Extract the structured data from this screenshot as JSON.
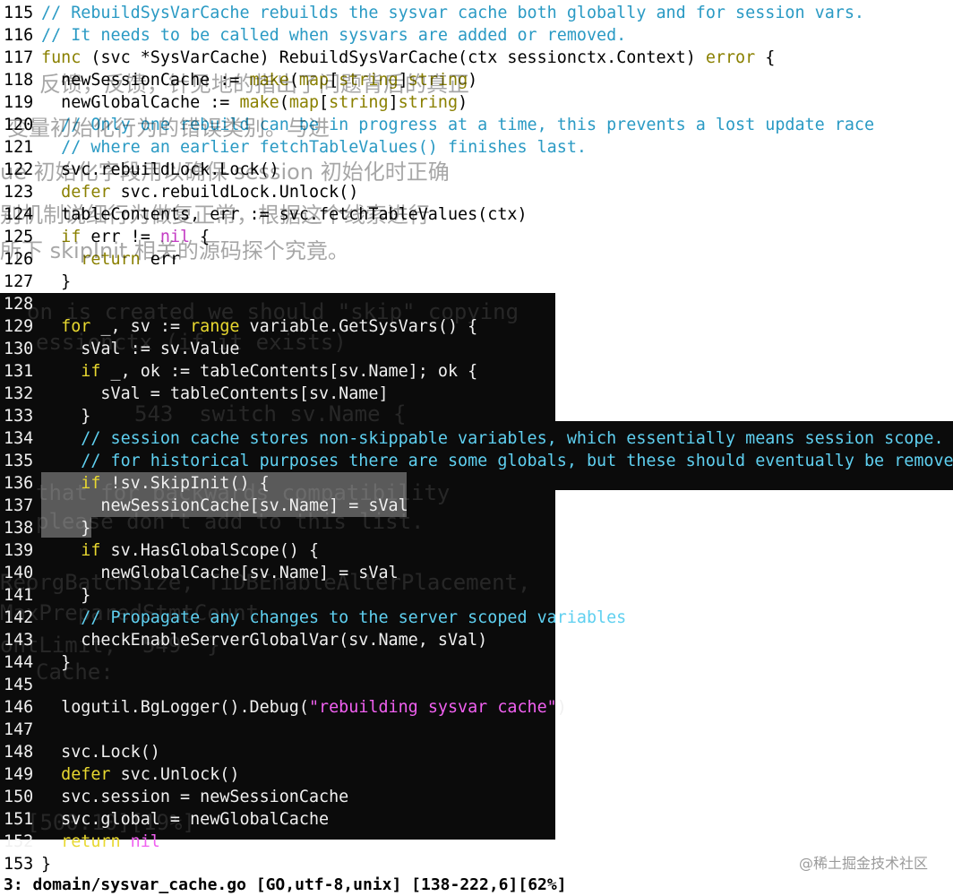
{
  "editor": {
    "lines": [
      {
        "n": "115",
        "segs": [
          [
            "com",
            "// RebuildSysVarCache rebuilds the sysvar cache both globally and for session vars."
          ]
        ]
      },
      {
        "n": "116",
        "segs": [
          [
            "com",
            "// It needs to be called when sysvars are added or removed."
          ]
        ]
      },
      {
        "n": "117",
        "segs": [
          [
            "kw",
            "func"
          ],
          [
            "plain",
            " (svc *SysVarCache) RebuildSysVarCache(ctx sessionctx.Context) "
          ],
          [
            "type",
            "error"
          ],
          [
            "plain",
            " {"
          ]
        ]
      },
      {
        "n": "118",
        "segs": [
          [
            "plain",
            "  newSessionCache := "
          ],
          [
            "kw",
            "make"
          ],
          [
            "plain",
            "("
          ],
          [
            "kw",
            "map"
          ],
          [
            "plain",
            "["
          ],
          [
            "type",
            "string"
          ],
          [
            "plain",
            "]"
          ],
          [
            "type",
            "string"
          ],
          [
            "plain",
            ")"
          ]
        ]
      },
      {
        "n": "119",
        "segs": [
          [
            "plain",
            "  newGlobalCache := "
          ],
          [
            "kw",
            "make"
          ],
          [
            "plain",
            "("
          ],
          [
            "kw",
            "map"
          ],
          [
            "plain",
            "["
          ],
          [
            "type",
            "string"
          ],
          [
            "plain",
            "]"
          ],
          [
            "type",
            "string"
          ],
          [
            "plain",
            ")"
          ]
        ]
      },
      {
        "n": "120",
        "segs": [
          [
            "com",
            "  // Only one rebuild can be in progress at a time, this prevents a lost update race"
          ]
        ]
      },
      {
        "n": "121",
        "segs": [
          [
            "com",
            "  // where an earlier fetchTableValues() finishes last."
          ]
        ]
      },
      {
        "n": "122",
        "segs": [
          [
            "plain",
            "  svc.rebuildLock.Lock()"
          ]
        ]
      },
      {
        "n": "123",
        "segs": [
          [
            "kw",
            "  defer"
          ],
          [
            "plain",
            " svc.rebuildLock.Unlock()"
          ]
        ]
      },
      {
        "n": "124",
        "segs": [
          [
            "plain",
            "  tableContents, err := svc.fetchTableValues(ctx)"
          ]
        ]
      },
      {
        "n": "125",
        "segs": [
          [
            "kw",
            "  if"
          ],
          [
            "plain",
            " err != "
          ],
          [
            "str",
            "nil"
          ],
          [
            "plain",
            " {"
          ]
        ]
      },
      {
        "n": "126",
        "segs": [
          [
            "kw",
            "    return"
          ],
          [
            "plain",
            " err"
          ]
        ]
      },
      {
        "n": "127",
        "segs": [
          [
            "plain",
            "  }"
          ]
        ]
      },
      {
        "n": "128",
        "segs": [
          [
            "plain",
            ""
          ]
        ]
      },
      {
        "n": "129",
        "segs": [
          [
            "kw",
            "  for"
          ],
          [
            "plain",
            " _, sv := "
          ],
          [
            "kw",
            "range"
          ],
          [
            "plain",
            " variable.GetSysVars() {"
          ]
        ]
      },
      {
        "n": "130",
        "segs": [
          [
            "plain",
            "    sVal := sv.Value"
          ]
        ]
      },
      {
        "n": "131",
        "segs": [
          [
            "kw",
            "    if"
          ],
          [
            "plain",
            " _, ok := tableContents[sv.Name]; ok {"
          ]
        ]
      },
      {
        "n": "132",
        "segs": [
          [
            "plain",
            "      sVal = tableContents[sv.Name]"
          ]
        ]
      },
      {
        "n": "133",
        "segs": [
          [
            "plain",
            "    }"
          ]
        ]
      },
      {
        "n": "134",
        "segs": [
          [
            "com",
            "    // session cache stores non-skippable variables, which essentially means session scope."
          ]
        ]
      },
      {
        "n": "135",
        "segs": [
          [
            "com",
            "    // for historical purposes there are some globals, but these should eventually be removed."
          ]
        ]
      },
      {
        "n": "136",
        "segs": [
          [
            "kw",
            "    if"
          ],
          [
            "plain",
            " !sv.SkipInit() {"
          ]
        ]
      },
      {
        "n": "137",
        "segs": [
          [
            "plain",
            "      newSessionCache[sv.Name] = sVal"
          ]
        ]
      },
      {
        "n": "138",
        "segs": [
          [
            "plain",
            "    }"
          ]
        ]
      },
      {
        "n": "139",
        "segs": [
          [
            "kw",
            "    if"
          ],
          [
            "plain",
            " sv.HasGlobalScope() {"
          ]
        ]
      },
      {
        "n": "140",
        "segs": [
          [
            "plain",
            "      newGlobalCache[sv.Name] = sVal"
          ]
        ]
      },
      {
        "n": "141",
        "segs": [
          [
            "plain",
            "    }"
          ]
        ]
      },
      {
        "n": "142",
        "segs": [
          [
            "com",
            "    // Propagate any changes to the server scoped variables"
          ]
        ]
      },
      {
        "n": "143",
        "segs": [
          [
            "plain",
            "    checkEnableServerGlobalVar(sv.Name, sVal)"
          ]
        ]
      },
      {
        "n": "144",
        "segs": [
          [
            "plain",
            "  }"
          ]
        ]
      },
      {
        "n": "145",
        "segs": [
          [
            "plain",
            ""
          ]
        ]
      },
      {
        "n": "146",
        "segs": [
          [
            "plain",
            "  logutil.BgLogger().Debug("
          ],
          [
            "str",
            "\"rebuilding sysvar cache\""
          ],
          [
            "plain",
            ")"
          ]
        ]
      },
      {
        "n": "147",
        "segs": [
          [
            "plain",
            ""
          ]
        ]
      },
      {
        "n": "148",
        "segs": [
          [
            "plain",
            "  svc.Lock()"
          ]
        ]
      },
      {
        "n": "149",
        "segs": [
          [
            "kw",
            "  defer"
          ],
          [
            "plain",
            " svc.Unlock()"
          ]
        ]
      },
      {
        "n": "150",
        "segs": [
          [
            "plain",
            "  svc.session = newSessionCache"
          ]
        ]
      },
      {
        "n": "151",
        "segs": [
          [
            "plain",
            "  svc.global = newGlobalCache"
          ]
        ]
      },
      {
        "n": "152",
        "segs": [
          [
            "kw",
            "  return"
          ],
          [
            "plain",
            " "
          ],
          [
            "str",
            "nil"
          ]
        ]
      },
      {
        "n": "153",
        "segs": [
          [
            "plain",
            "}"
          ]
        ]
      }
    ]
  },
  "status": {
    "text": "3: domain/sysvar_cache.go [GO,utf-8,unix] [138-222,6][62%]"
  },
  "watermark": "@稀土掘金技术社区",
  "ghost_light": [
    {
      "text": "反馈，反馈，针见地的指出了问题背后的真正"
    },
    {
      "text": "变量初始化行为的错误类别。与进"
    },
    {
      "text": "ue 初始化字段用以确保 session 初始化时正确"
    },
    {
      "text": "别机制说细行为做复正常，根据这个线索进行"
    },
    {
      "text": "所下 skipInit 相关的源码探个究竟。"
    }
  ],
  "ghost_dark": [
    {
      "text": "on is created we should \"skip\" copying"
    },
    {
      "text": "essionctx (if it exists)"
    },
    {
      "text": "543  switch sv.Name {"
    },
    {
      "text": "that for backwards compatibility"
    },
    {
      "text": "please don't add to this list."
    },
    {
      "text": "ReorgBatchSize, TiDBEnableAlterPlacement,"
    },
    {
      "text": "MaxPreparedStmtCount"
    },
    {
      "text": "ontLimit,  549  }"
    },
    {
      "text": "Cache:"
    },
    {
      "text": "[500:10][19%]"
    }
  ],
  "colors": {
    "comment": "#2a9ac4",
    "keyword": "#8a8000",
    "string": "#c43cc4",
    "dark_bg": "#0b0b0b",
    "selection": "#5a5a5a"
  }
}
